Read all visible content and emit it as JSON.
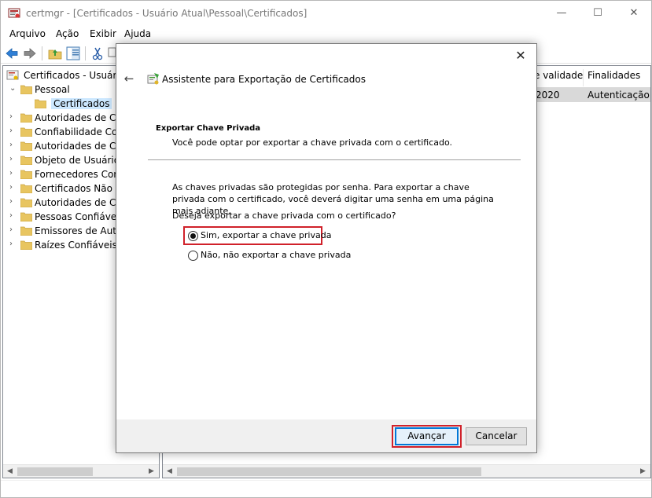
{
  "window": {
    "title": "certmgr - [Certificados - Usuário Atual\\Pessoal\\Certificados]",
    "minimize": "—",
    "maximize": "☐",
    "close": "✕"
  },
  "menu": [
    "Arquivo",
    "Ação",
    "Exibir",
    "Ajuda"
  ],
  "tree": {
    "root": "Certificados - Usuário Atual",
    "pessoal": "Pessoal",
    "certificados": "Certificados",
    "items": [
      "Autoridades de Certificação Raiz Confiáveis",
      "Confiabilidade Corporativa",
      "Autoridades de Certificação Intermediárias",
      "Objeto de Usuário do Active Directory",
      "Fornecedores Confiáveis",
      "Certificados Não Confiáveis",
      "Autoridades de Certificação Raiz de Terceiros",
      "Pessoas Confiáveis",
      "Emissores de Autenticação de Cliente",
      "Raízes Confiáveis de Cartão Inteligente"
    ]
  },
  "list": {
    "columns": [
      "e validade",
      "Finalidades"
    ],
    "row": [
      "2020",
      "Autenticação d"
    ]
  },
  "dialog": {
    "close": "✕",
    "back": "←",
    "title": "Assistente para Exportação de Certificados",
    "section_title": "Exportar Chave Privada",
    "section_subtitle": "Você pode optar por exportar a chave privada com o certificado.",
    "info": "As chaves privadas são protegidas por senha. Para exportar a chave privada com o certificado, você deverá digitar uma senha em uma página mais adiante.",
    "question": "Deseja exportar a chave privada com o certificado?",
    "option_yes": "Sim, exportar a chave privada",
    "option_no": "Não, não exportar a chave privada",
    "selected": "yes",
    "next_button": "Avançar",
    "cancel_button": "Cancelar"
  },
  "colors": {
    "highlight": "#d0212a",
    "selection": "#cce8ff",
    "primary_border": "#0078d7",
    "folder": "#e8c560"
  }
}
